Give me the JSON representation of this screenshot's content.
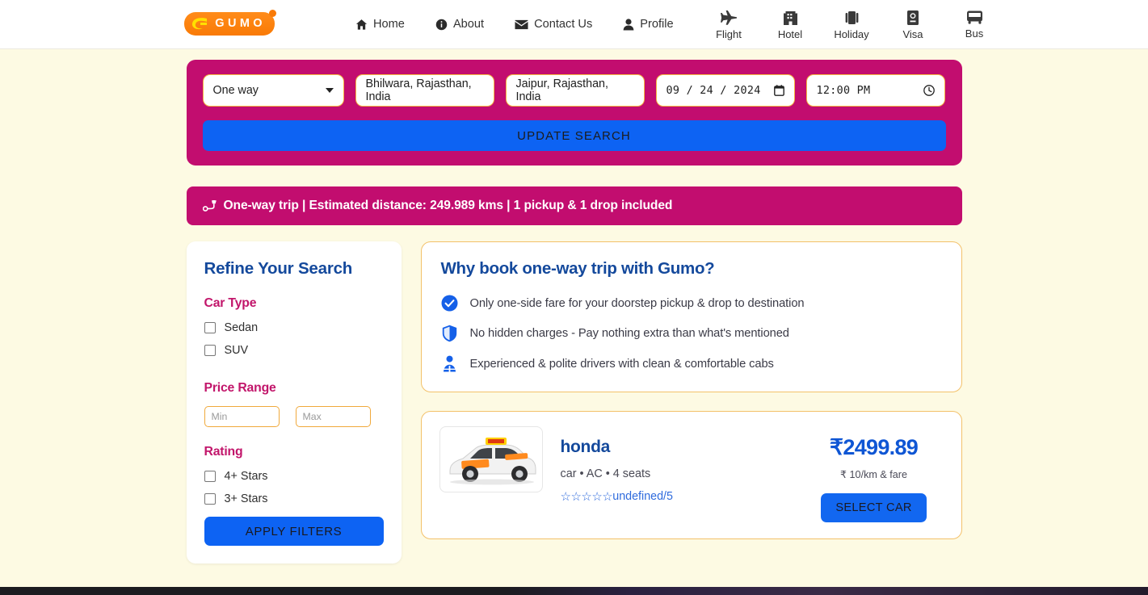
{
  "header": {
    "logo": {
      "text": "GUMO",
      "icon": "gumo-swoosh-icon"
    },
    "nav": [
      {
        "label": "Home",
        "icon": "home-icon"
      },
      {
        "label": "About",
        "icon": "info-circle-icon"
      },
      {
        "label": "Contact Us",
        "icon": "envelope-icon"
      },
      {
        "label": "Profile",
        "icon": "user-icon"
      }
    ],
    "services": [
      {
        "label": "Flight",
        "icon": "plane-icon"
      },
      {
        "label": "Hotel",
        "icon": "hotel-icon"
      },
      {
        "label": "Holiday",
        "icon": "suitcase-icon"
      },
      {
        "label": "Visa",
        "icon": "passport-icon"
      },
      {
        "label": "Bus",
        "icon": "bus-icon"
      }
    ]
  },
  "search": {
    "trip_type": "One way",
    "pickup": "Bhilwara, Rajasthan, India",
    "drop": "Jaipur, Rajasthan, India",
    "date": "09 / 24 / 2024",
    "time": "12:00  PM",
    "update_label": "UPDATE SEARCH",
    "panel_color": "#c20d6f",
    "button_color": "#0d63f3"
  },
  "trip_banner": {
    "icon": "route-icon",
    "text": "One-way trip | Estimated distance: 249.989 kms | 1 pickup & 1 drop included"
  },
  "sidebar": {
    "title": "Refine Your Search",
    "car_type": {
      "heading": "Car Type",
      "options": [
        {
          "label": "Sedan",
          "checked": false
        },
        {
          "label": "SUV",
          "checked": false
        }
      ]
    },
    "price_range": {
      "heading": "Price Range",
      "min_placeholder": "Min",
      "max_placeholder": "Max",
      "min_value": "",
      "max_value": ""
    },
    "rating": {
      "heading": "Rating",
      "options": [
        {
          "label": "4+ Stars",
          "checked": false
        },
        {
          "label": "3+ Stars",
          "checked": false
        }
      ]
    },
    "apply_label": "APPLY FILTERS"
  },
  "why_card": {
    "title": "Why book one-way trip with Gumo?",
    "points": [
      {
        "icon": "check-circle-icon",
        "text": "Only one-side fare for your doorstep pickup & drop to destination"
      },
      {
        "icon": "shield-icon",
        "text": "No hidden charges - Pay nothing extra than what's mentioned"
      },
      {
        "icon": "driver-icon",
        "text": "Experienced & polite drivers with clean & comfortable cabs"
      }
    ]
  },
  "results": [
    {
      "image_alt": "white-sedan-taxi",
      "name": "honda",
      "specs": "car • AC • 4 seats",
      "stars": "☆☆☆☆☆",
      "rating_text": "undefined/5",
      "price": "₹2499.89",
      "rate": "₹ 10/km & fare",
      "select_label": "SELECT CAR"
    }
  ]
}
